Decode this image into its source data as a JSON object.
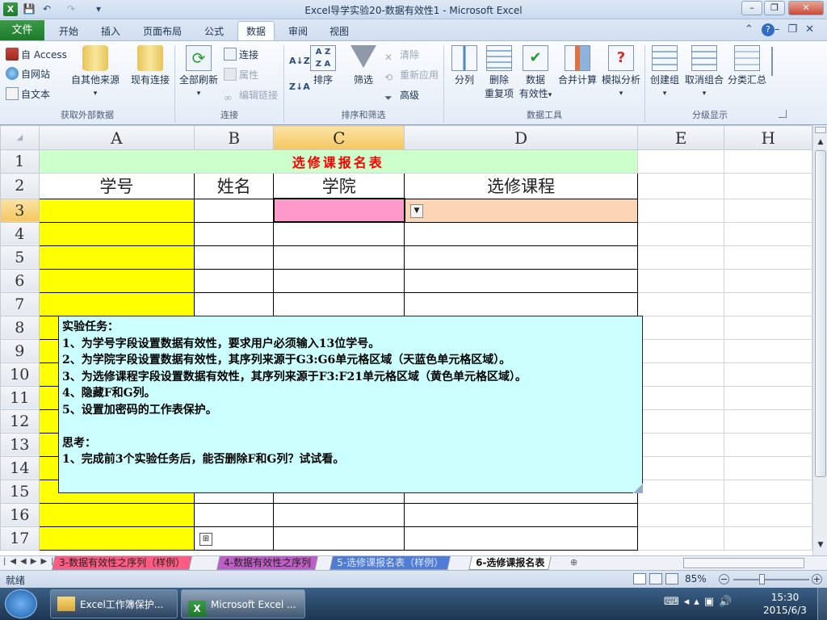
{
  "window": {
    "title": "Excel导学实验20-数据有效性1  -  Microsoft Excel"
  },
  "qat": {
    "save": "💾",
    "undo": "↶",
    "redo": "↷",
    "customize": "▾"
  },
  "window_buttons": {
    "minimize": "–",
    "restore": "❐",
    "close": "✕"
  },
  "tabs": [
    {
      "label": "文件"
    },
    {
      "label": "开始"
    },
    {
      "label": "插入"
    },
    {
      "label": "页面布局"
    },
    {
      "label": "公式"
    },
    {
      "label": "数据"
    },
    {
      "label": "审阅"
    },
    {
      "label": "视图"
    }
  ],
  "ribbon": {
    "groups": {
      "external": "获取外部数据",
      "connections": "连接",
      "sort_filter": "排序和筛选",
      "data_tools": "数据工具",
      "outline": "分级显示"
    },
    "external": {
      "access": "自 Access",
      "web": "自网站",
      "text": "自文本",
      "other": "自其他来源",
      "existing": "现有连接"
    },
    "connections": {
      "refresh_all": "全部刷新",
      "connections": "连接",
      "properties": "属性",
      "edit_links": "编辑链接"
    },
    "sort_filter": {
      "sort": "排序",
      "filter": "筛选",
      "clear": "清除",
      "reapply": "重新应用",
      "advanced": "高级"
    },
    "data_tools": {
      "text_to_columns": "分列",
      "remove_dup_1": "删除",
      "remove_dup_2": "重复项",
      "validation_1": "数据",
      "validation_2": "有效性",
      "consolidate": "合并计算",
      "what_if": "模拟分析"
    },
    "outline": {
      "group": "创建组",
      "ungroup": "取消组合",
      "subtotal": "分类汇总"
    }
  },
  "columns": [
    "A",
    "B",
    "C",
    "D",
    "E",
    "H"
  ],
  "rows": [
    "1",
    "2",
    "3",
    "4",
    "5",
    "6",
    "7",
    "8",
    "9",
    "10",
    "11",
    "12",
    "13",
    "14",
    "15",
    "16",
    "17"
  ],
  "sheet": {
    "title": "选修课报名表",
    "headers": [
      "学号",
      "姓名",
      "学院",
      "选修课程"
    ]
  },
  "note": {
    "lines": [
      "实验任务：",
      "1、为学号字段设置数据有效性，要求用户必须输入13位学号。",
      "2、为学院字段设置数据有效性，其序列来源于G3:G6单元格区域（天蓝色单元格区域）。",
      "3、为选修课程字段设置数据有效性，其序列来源于F3:F21单元格区域（黄色单元格区域）。",
      "4、隐藏F和G列。",
      "5、设置加密码的工作表保护。",
      "",
      "思考：",
      "1、完成前3个实验任务后，能否删除F和G列？试试看。"
    ]
  },
  "sheet_tabs": [
    {
      "label": "3-数据有效性之序列（样例）"
    },
    {
      "label": "4-数据有效性之序列"
    },
    {
      "label": "5-选修课报名表（样例）"
    },
    {
      "label": "6-选修课报名表"
    }
  ],
  "status": {
    "ready": "就绪",
    "zoom": "85%"
  },
  "taskbar": {
    "items": [
      "Excel工作簿保护...",
      "Microsoft Excel ..."
    ],
    "time": "15:30",
    "date": "2015/6/3"
  },
  "colors": {
    "yellow": "#ffff00",
    "pink": "#ff99cc",
    "orange": "#fcd5b4",
    "light_green": "#ccffcc",
    "note": "#ccffff",
    "title_red": "#ff0000"
  }
}
